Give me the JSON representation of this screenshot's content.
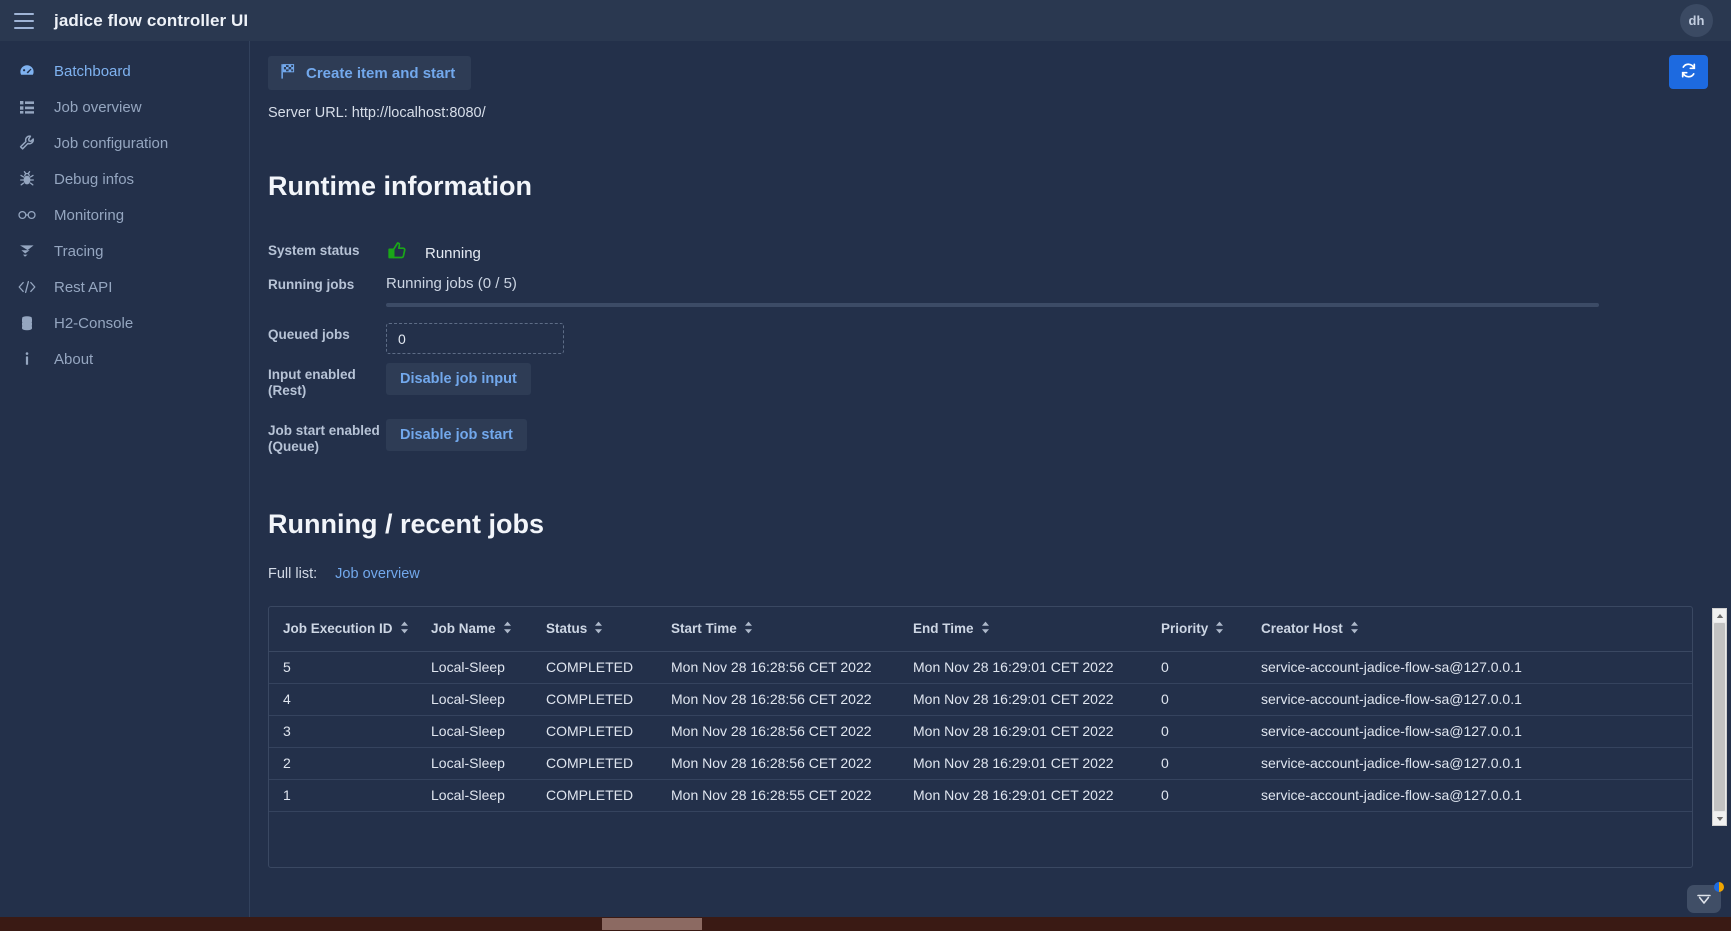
{
  "header": {
    "title": "jadice flow controller UI",
    "menu_icon": "hamburger-icon",
    "avatar_initials": "dh"
  },
  "sidebar": {
    "items": [
      {
        "label": "Batchboard",
        "icon": "dashboard-icon",
        "active": true
      },
      {
        "label": "Job overview",
        "icon": "list-icon",
        "active": false
      },
      {
        "label": "Job configuration",
        "icon": "wrench-icon",
        "active": false
      },
      {
        "label": "Debug infos",
        "icon": "bug-icon",
        "active": false
      },
      {
        "label": "Monitoring",
        "icon": "glasses-icon",
        "active": false
      },
      {
        "label": "Tracing",
        "icon": "tracing-icon",
        "active": false
      },
      {
        "label": "Rest API",
        "icon": "code-icon",
        "active": false
      },
      {
        "label": "H2-Console",
        "icon": "database-icon",
        "active": false
      },
      {
        "label": "About",
        "icon": "info-icon",
        "active": false
      }
    ]
  },
  "toolbar": {
    "create_label": "Create item and start",
    "create_icon": "checkered-flag-icon",
    "refresh_icon": "refresh-icon",
    "refresh_color": "#1d6ae0"
  },
  "server_url_line": "Server URL: http://localhost:8080/",
  "runtime": {
    "title": "Runtime information",
    "system_status_label": "System status",
    "system_status_value": "Running",
    "system_status_icon": "thumbs-up-icon",
    "system_status_color": "#1aa818",
    "running_jobs_label": "Running jobs",
    "running_jobs_value": "Running jobs (0 / 5)",
    "running_jobs_progress_percent": 0,
    "queued_jobs_label": "Queued jobs",
    "queued_jobs_value": "0",
    "input_enabled_label": "Input enabled (Rest)",
    "input_enabled_button": "Disable job input",
    "job_start_enabled_label": "Job start enabled (Queue)",
    "job_start_enabled_button": "Disable job start"
  },
  "jobs": {
    "title": "Running / recent jobs",
    "full_list_label": "Full list:",
    "full_list_link": "Job overview",
    "columns": [
      "Job Execution ID",
      "Job Name",
      "Status",
      "Start Time",
      "End Time",
      "Priority",
      "Creator Host"
    ],
    "rows": [
      {
        "id": "5",
        "name": "Local-Sleep",
        "status": "COMPLETED",
        "start": "Mon Nov 28 16:28:56 CET 2022",
        "end": "Mon Nov 28 16:29:01 CET 2022",
        "priority": "0",
        "host": "service-account-jadice-flow-sa@127.0.0.1"
      },
      {
        "id": "4",
        "name": "Local-Sleep",
        "status": "COMPLETED",
        "start": "Mon Nov 28 16:28:56 CET 2022",
        "end": "Mon Nov 28 16:29:01 CET 2022",
        "priority": "0",
        "host": "service-account-jadice-flow-sa@127.0.0.1"
      },
      {
        "id": "3",
        "name": "Local-Sleep",
        "status": "COMPLETED",
        "start": "Mon Nov 28 16:28:56 CET 2022",
        "end": "Mon Nov 28 16:29:01 CET 2022",
        "priority": "0",
        "host": "service-account-jadice-flow-sa@127.0.0.1"
      },
      {
        "id": "2",
        "name": "Local-Sleep",
        "status": "COMPLETED",
        "start": "Mon Nov 28 16:28:56 CET 2022",
        "end": "Mon Nov 28 16:29:01 CET 2022",
        "priority": "0",
        "host": "service-account-jadice-flow-sa@127.0.0.1"
      },
      {
        "id": "1",
        "name": "Local-Sleep",
        "status": "COMPLETED",
        "start": "Mon Nov 28 16:28:55 CET 2022",
        "end": "Mon Nov 28 16:29:01 CET 2022",
        "priority": "0",
        "host": "service-account-jadice-flow-sa@127.0.0.1"
      }
    ]
  }
}
